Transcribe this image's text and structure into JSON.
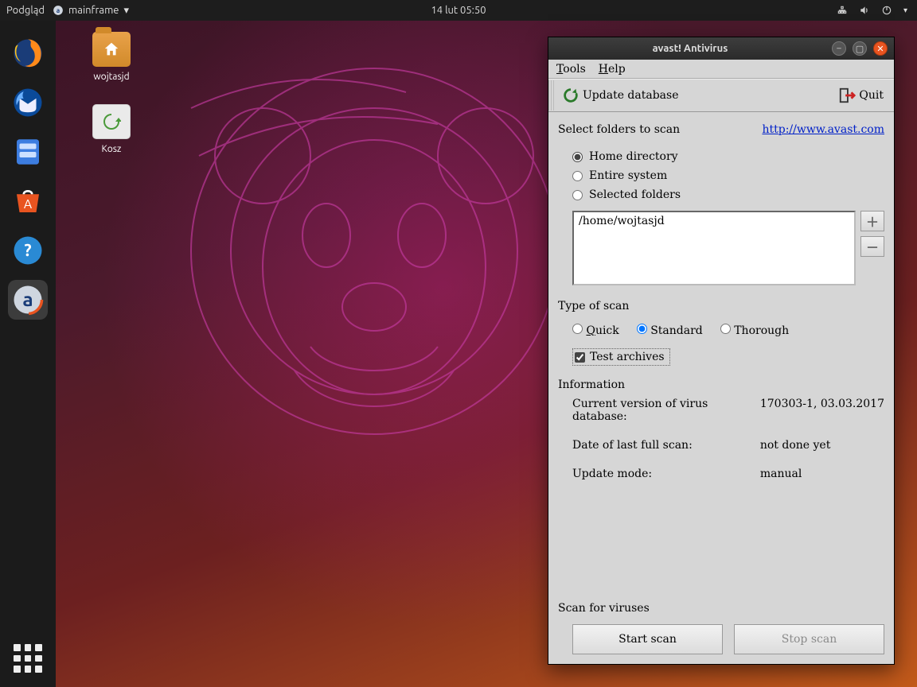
{
  "topbar": {
    "activities": "Podgląd",
    "appmenu": "mainframe",
    "clock": "14 lut  05:50"
  },
  "dock": {
    "items": [
      "firefox",
      "thunderbird",
      "files",
      "software",
      "help",
      "avast"
    ]
  },
  "desktop": {
    "home_label": "wojtasjd",
    "trash_label": "Kosz"
  },
  "window": {
    "title": "avast! Antivirus",
    "menu": {
      "tools": "Tools",
      "help": "Help"
    },
    "toolbar": {
      "update": "Update database",
      "quit": "Quit"
    },
    "select_label": "Select folders to scan",
    "url": "http://www.avast.com",
    "radios": {
      "home": "Home directory",
      "entire": "Entire system",
      "selected": "Selected folders"
    },
    "folder_path": "/home/wojtasjd",
    "type_label": "Type of scan",
    "types": {
      "quick": "Quick",
      "standard": "Standard",
      "thorough": "Thorough"
    },
    "test_archives": "Test archives",
    "info_label": "Information",
    "info": {
      "db_label": "Current version of virus database:",
      "db_value": "170303-1, 03.03.2017",
      "last_label": "Date of last full scan:",
      "last_value": "not done yet",
      "mode_label": "Update mode:",
      "mode_value": "manual"
    },
    "scan_label": "Scan for viruses",
    "start": "Start scan",
    "stop": "Stop scan"
  }
}
